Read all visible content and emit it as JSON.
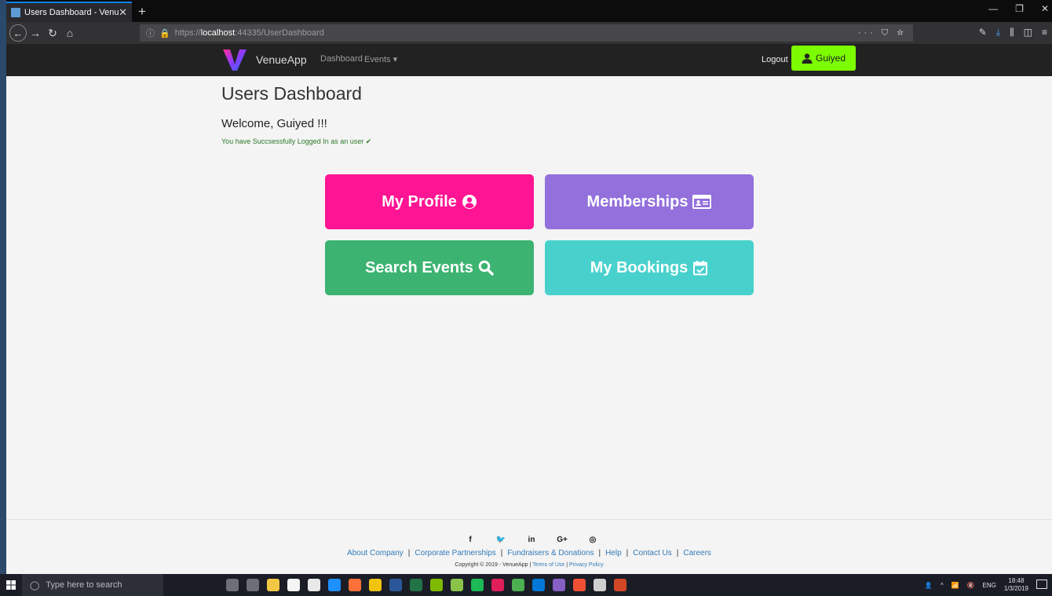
{
  "browser": {
    "tab_title": "Users Dashboard - VenueApp",
    "tab_close": "✕",
    "new_tab": "+",
    "url_proto": "https://",
    "url_host": "localhost",
    "url_rest": ":44335/UserDashboard",
    "url_actions": "··· ⛉ ☆"
  },
  "header": {
    "brand": "VenueApp",
    "nav_dashboard": "Dashboard",
    "nav_events": "Events ▾",
    "logout": "Logout",
    "user": "Guiyed"
  },
  "main": {
    "title": "Users Dashboard",
    "welcome": "Welcome, Guiyed !!!",
    "success": "You have Succsessfully Logged In as an user ✔",
    "cards": {
      "profile": "My Profile",
      "memberships": "Memberships",
      "search": "Search Events",
      "bookings": "My Bookings"
    }
  },
  "colors": {
    "profile": "#ff1493",
    "memberships": "#9370db",
    "search": "#3cb371",
    "bookings": "#48d1cc",
    "user_button": "#7cfc00"
  },
  "footer": {
    "social_icons": [
      "facebook-icon",
      "twitter-icon",
      "linkedin-icon",
      "google-plus-icon",
      "instagram-icon"
    ],
    "links": {
      "about": "About Company",
      "corporate": "Corporate Partnerships",
      "fundraisers": "Fundraisers & Donations",
      "help": "Help",
      "contact": "Contact Us",
      "careers": "Careers"
    },
    "separator": "|",
    "copyright": "Copyright © 2019 - VenueApp |",
    "terms": "Terms of Use",
    "privacy": "Privacy Policy"
  },
  "taskbar": {
    "search_placeholder": "Type here to search",
    "lang": "ENG",
    "time": "18:48",
    "date": "1/3/2019"
  }
}
